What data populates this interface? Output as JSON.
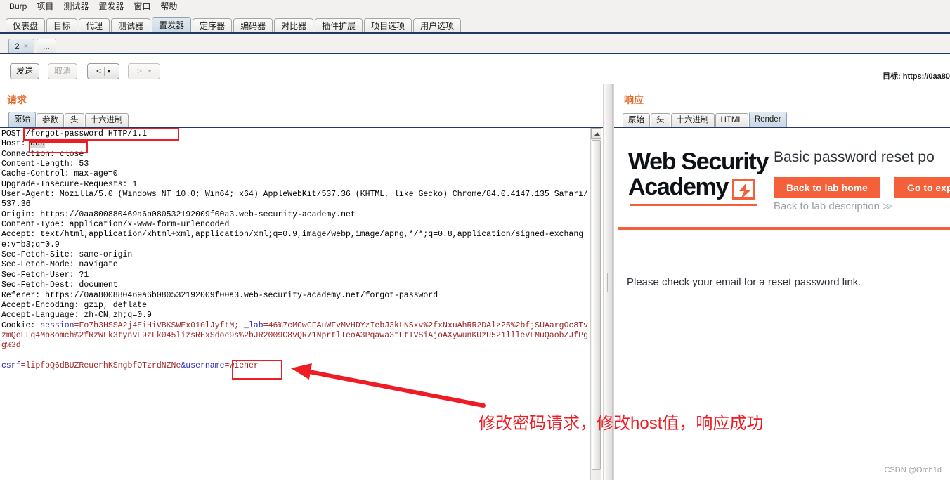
{
  "menubar": {
    "items": [
      "Burp",
      "项目",
      "测试器",
      "置发器",
      "窗口",
      "帮助"
    ]
  },
  "product_tabs": {
    "items": [
      {
        "label": "仪表盘",
        "selected": false
      },
      {
        "label": "目标",
        "selected": false
      },
      {
        "label": "代理",
        "selected": false
      },
      {
        "label": "测试器",
        "selected": false
      },
      {
        "label": "置发器",
        "selected": true
      },
      {
        "label": "定序器",
        "selected": false
      },
      {
        "label": "编码器",
        "selected": false
      },
      {
        "label": "对比器",
        "selected": false
      },
      {
        "label": "插件扩展",
        "selected": false
      },
      {
        "label": "项目选项",
        "selected": false
      },
      {
        "label": "用户选项",
        "selected": false
      }
    ]
  },
  "repeater_tabs": {
    "items": [
      {
        "label": "2",
        "close": "×",
        "selected": true
      },
      {
        "label": "...",
        "selected": false
      }
    ]
  },
  "toolbar": {
    "send_label": "发送",
    "cancel_label": "取消",
    "prev_glyph": "<",
    "next_glyph": ">",
    "caret_glyph": "▾",
    "target_label": "目标: https://0aa80"
  },
  "request": {
    "title": "请求",
    "view_tabs": [
      {
        "label": "原始",
        "selected": true
      },
      {
        "label": "参数",
        "selected": false
      },
      {
        "label": "头",
        "selected": false
      },
      {
        "label": "十六进制",
        "selected": false
      }
    ],
    "lines": {
      "request_line": "POST /forgot-password HTTP/1.1",
      "host": "Host: aaa",
      "host_value": "aaa",
      "connection": "Connection: close",
      "content_length": "Content-Length: 53",
      "cache_control": "Cache-Control: max-age=0",
      "upgrade_insecure": "Upgrade-Insecure-Requests: 1",
      "user_agent": "User-Agent: Mozilla/5.0 (Windows NT 10.0; Win64; x64) AppleWebKit/537.36 (KHTML, like Gecko) Chrome/84.0.4147.135 Safari/537.36",
      "origin": "Origin: https://0aa800880469a6b080532192009f00a3.web-security-academy.net",
      "content_type": "Content-Type: application/x-www-form-urlencoded",
      "accept": "Accept: text/html,application/xhtml+xml,application/xml;q=0.9,image/webp,image/apng,*/*;q=0.8,application/signed-exchange;v=b3;q=0.9",
      "sec_fetch_site": "Sec-Fetch-Site: same-origin",
      "sec_fetch_mode": "Sec-Fetch-Mode: navigate",
      "sec_fetch_user": "Sec-Fetch-User: ?1",
      "sec_fetch_dest": "Sec-Fetch-Dest: document",
      "referer": "Referer: https://0aa800880469a6b080532192009f00a3.web-security-academy.net/forgot-password",
      "accept_encoding": "Accept-Encoding: gzip, deflate",
      "accept_language": "Accept-Language: zh-CN,zh;q=0.9",
      "cookie_label": "Cookie: ",
      "cookie_session_name": "session",
      "cookie_session_eq": "=",
      "cookie_session_value": "Fo7h3HSSA2j4EiHiVBKSWEx01GlJyftM;",
      "cookie_lab_name": " _lab",
      "cookie_lab_eq": "=",
      "cookie_lab_value": "46%7cMCwCFAuWFvMvHDYzIebJ3kLNSxv%2fxNxuAhRR2DAlz25%2bfjSUAargOc8TvzmQeFLq4Mb8omch%2fRzWLk3tynvF9zLk045lizsRExSdoe9s%2bJR2009C8vQR71NprtlTeoA3Pqawa3tFtIVSiAjoAXywunKUzU521llleVLMuQaobZJfPgg%3d",
      "body_csrf_name": "csrf",
      "body_csrf_eq": "=",
      "body_csrf_value": "lipfoQ6dBUZReuerhKSngbfOTzrdNZNe",
      "body_amp": "&",
      "body_username_name": "username",
      "body_username_eq": "=",
      "body_username_value": "wiener"
    }
  },
  "response": {
    "title": "响应",
    "view_tabs": [
      {
        "label": "原始",
        "selected": false
      },
      {
        "label": "头",
        "selected": false
      },
      {
        "label": "十六进制",
        "selected": false
      },
      {
        "label": "HTML",
        "selected": false
      },
      {
        "label": "Render",
        "selected": true
      }
    ],
    "render": {
      "logo_line1": "Web Security",
      "logo_line2": "Academy",
      "lab_title": "Basic password reset po",
      "btn_lab_home": "Back to lab home",
      "btn_exploit": "Go to exp",
      "lab_description": "Back to lab description",
      "lab_description_chevron": "≫",
      "message": "Please check your email for a reset password link."
    }
  },
  "annotations": {
    "note": "修改密码请求，修改host值，响应成功",
    "accent_red": "#ee1c25",
    "accent_orange": "#f4603a"
  },
  "watermark": "CSDN @Orch1d"
}
